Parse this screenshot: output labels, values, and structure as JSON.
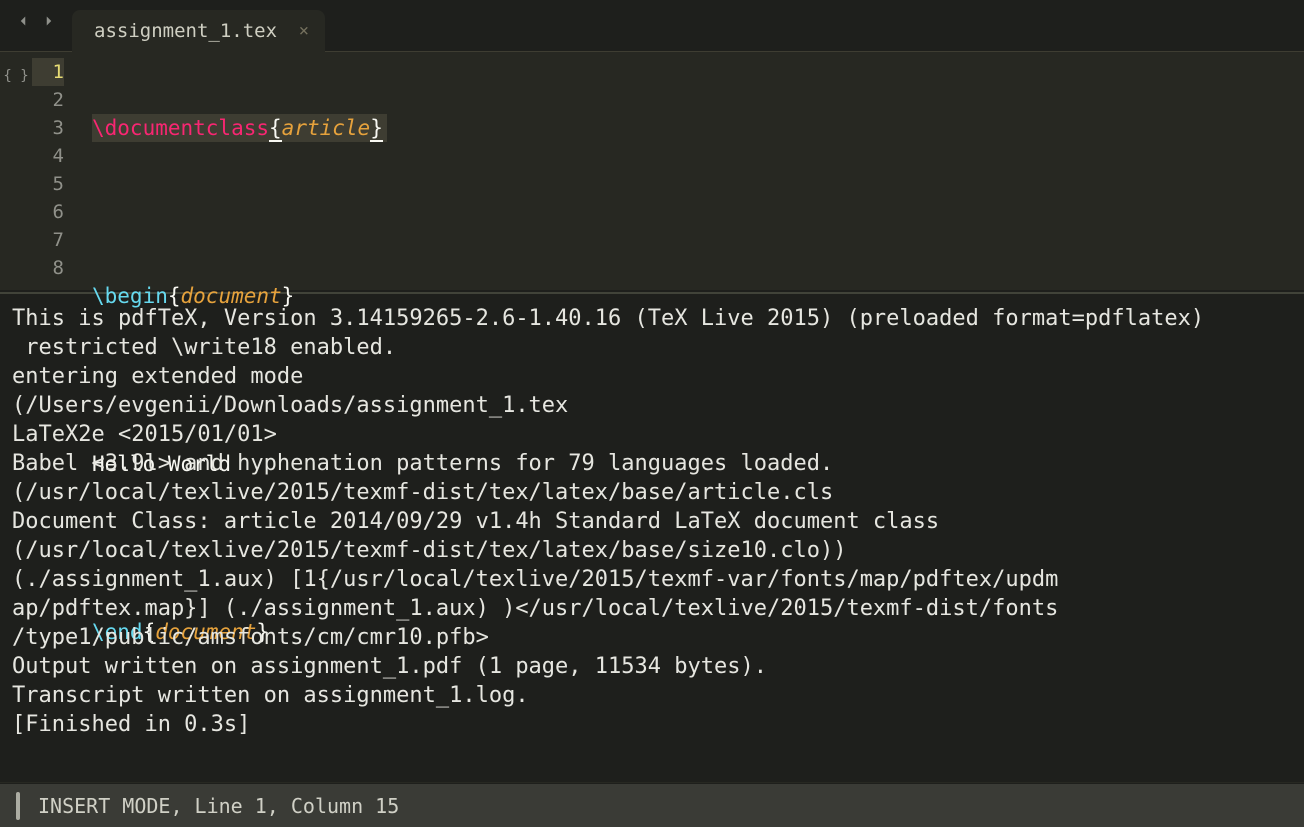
{
  "tab": {
    "filename": "assignment_1.tex"
  },
  "line_numbers": [
    "1",
    "2",
    "3",
    "4",
    "5",
    "6",
    "7",
    "8"
  ],
  "code": {
    "l1_cmd": "\\documentclass",
    "l1_arg": "article",
    "l3_cmd": "\\begin",
    "l3_arg": "document",
    "l5_text": "Hello World",
    "l7_cmd": "\\end",
    "l7_arg": "document"
  },
  "build_output": "This is pdfTeX, Version 3.14159265-2.6-1.40.16 (TeX Live 2015) (preloaded format=pdflatex)\n restricted \\write18 enabled.\nentering extended mode\n(/Users/evgenii/Downloads/assignment_1.tex\nLaTeX2e <2015/01/01>\nBabel <3.9l> and hyphenation patterns for 79 languages loaded.\n(/usr/local/texlive/2015/texmf-dist/tex/latex/base/article.cls\nDocument Class: article 2014/09/29 v1.4h Standard LaTeX document class\n(/usr/local/texlive/2015/texmf-dist/tex/latex/base/size10.clo))\n(./assignment_1.aux) [1{/usr/local/texlive/2015/texmf-var/fonts/map/pdftex/updm\nap/pdftex.map}] (./assignment_1.aux) )</usr/local/texlive/2015/texmf-dist/fonts\n/type1/public/amsfonts/cm/cmr10.pfb>\nOutput written on assignment_1.pdf (1 page, 11534 bytes).\nTranscript written on assignment_1.log.\n[Finished in 0.3s]",
  "status": {
    "text": "INSERT MODE, Line 1, Column 15"
  }
}
